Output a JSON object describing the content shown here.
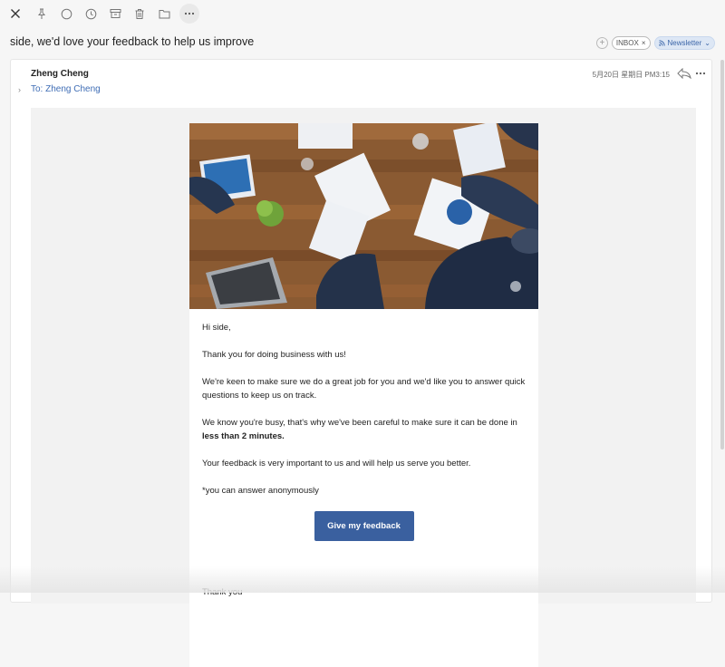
{
  "toolbar": {
    "icons": [
      "close-icon",
      "pin-icon",
      "circle-icon",
      "clock-icon",
      "archive-icon",
      "trash-icon",
      "folder-icon",
      "more-icon"
    ]
  },
  "subject": "side, we'd love your feedback to help us improve",
  "tags": {
    "add": "+",
    "inbox": "INBOX",
    "inbox_close": "×",
    "newsletter": "Newsletter",
    "newsletter_chevron": "⌄"
  },
  "message": {
    "sender": "Zheng Cheng",
    "to": "To: Zheng Cheng",
    "date": "5月20日 星期日 PM3:15"
  },
  "email": {
    "greeting": "Hi side,",
    "p1": "Thank you for doing business with us!",
    "p2": "We're keen to make sure we do a great job for you and we'd like you to answer quick questions to keep us on track.",
    "p3_a": "We know you're busy, that's why we've been careful to make sure it can be done in ",
    "p3_b": "less than 2 minutes.",
    "p4": "Your feedback is very important to us and will help us serve you better.",
    "p5": "*you can answer anonymously",
    "cta": "Give my feedback",
    "closing": "Thank you"
  },
  "colors": {
    "accent": "#3a609f",
    "link": "#3f6db5",
    "tag_bg": "#dde7f5"
  }
}
